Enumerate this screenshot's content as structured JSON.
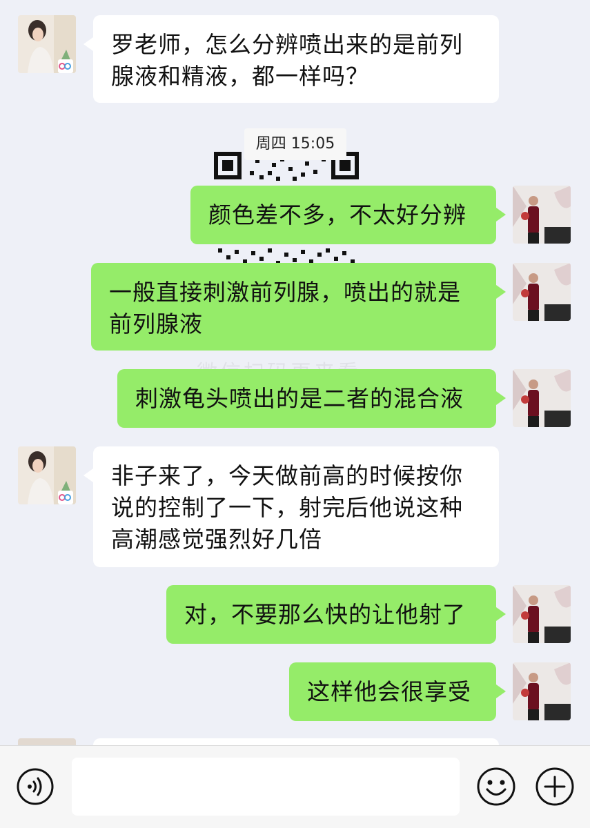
{
  "conversation": {
    "timestamp": "周四 15:05",
    "messages": [
      {
        "side": "in",
        "text": "罗老师，怎么分辨喷出来的是前列腺液和精液，都一样吗？"
      },
      {
        "side": "out",
        "text": "颜色差不多，不太好分辨"
      },
      {
        "side": "out",
        "text": "一般直接刺激前列腺，喷出的就是前列腺液"
      },
      {
        "side": "out",
        "text": "刺激龟头喷出的是二者的混合液"
      },
      {
        "side": "in",
        "text": "非子来了，今天做前高的时候按你说的控制了一下，射完后他说这种高潮感觉强烈好几倍"
      },
      {
        "side": "out",
        "text": "对，不要那么快的让他射了"
      },
      {
        "side": "out",
        "text": "这样他会很享受"
      }
    ]
  },
  "input_bar": {
    "voice_icon": "voice-icon",
    "emoji_icon": "emoji-icon",
    "plus_icon": "plus-icon",
    "message_value": ""
  },
  "colors": {
    "chat_background": "#eef0f7",
    "outgoing_bubble": "#95ec69",
    "incoming_bubble": "#ffffff",
    "input_bar_background": "#f6f6f6"
  }
}
